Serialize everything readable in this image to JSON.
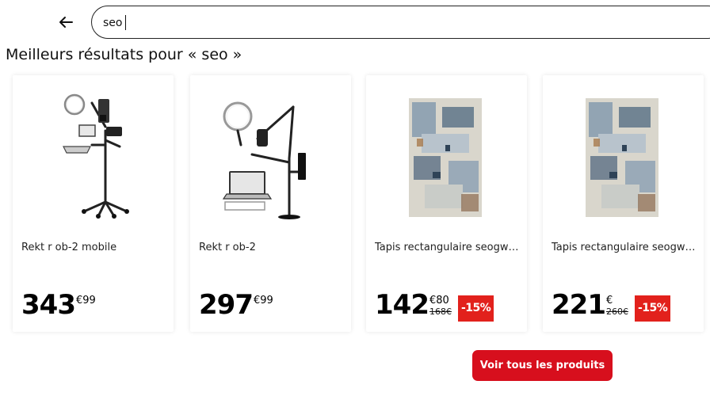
{
  "search": {
    "query": "seo",
    "back_icon": "arrow-left-icon"
  },
  "results_title": "Meilleurs résultats pour « seo »",
  "colors": {
    "accent": "#d70f1d",
    "discount": "#e2211c"
  },
  "products": [
    {
      "name": "Rekt r ob-2 mobile",
      "price_int": "343",
      "price_cents": "€99",
      "image": "mobile-studio-stand-image"
    },
    {
      "name": "Rekt r ob-2",
      "price_int": "297",
      "price_cents": "€99",
      "image": "desk-studio-arm-image"
    },
    {
      "name": "Tapis rectangulaire seogwipo",
      "price_int": "142",
      "price_cents": "€80",
      "old_price": "168€",
      "discount": "-15%",
      "image": "rug-image"
    },
    {
      "name": "Tapis rectangulaire seogwipo",
      "price_int": "221",
      "price_cents": "€",
      "old_price": "260€",
      "discount": "-15%",
      "image": "rug-image"
    }
  ],
  "see_all_label": "Voir tous les produits"
}
